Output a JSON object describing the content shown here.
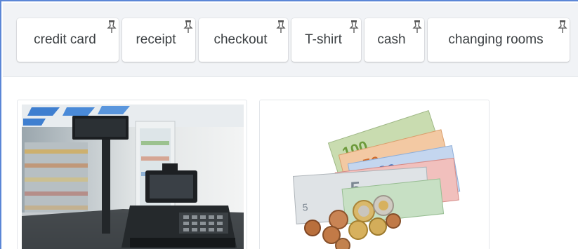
{
  "word_bank": {
    "chips": [
      {
        "label": "credit card"
      },
      {
        "label": "receipt"
      },
      {
        "label": "checkout"
      },
      {
        "label": "T-shirt"
      },
      {
        "label": "cash"
      },
      {
        "label": "changing rooms"
      }
    ],
    "chip_icon": "pin-icon"
  },
  "cards": [
    {
      "image": "checkout-counter-image"
    },
    {
      "image": "euro-cash-image"
    }
  ],
  "colors": {
    "frame_border": "#5b86d6",
    "bank_background": "#f1f3f6",
    "chip_text": "#3c4043"
  }
}
